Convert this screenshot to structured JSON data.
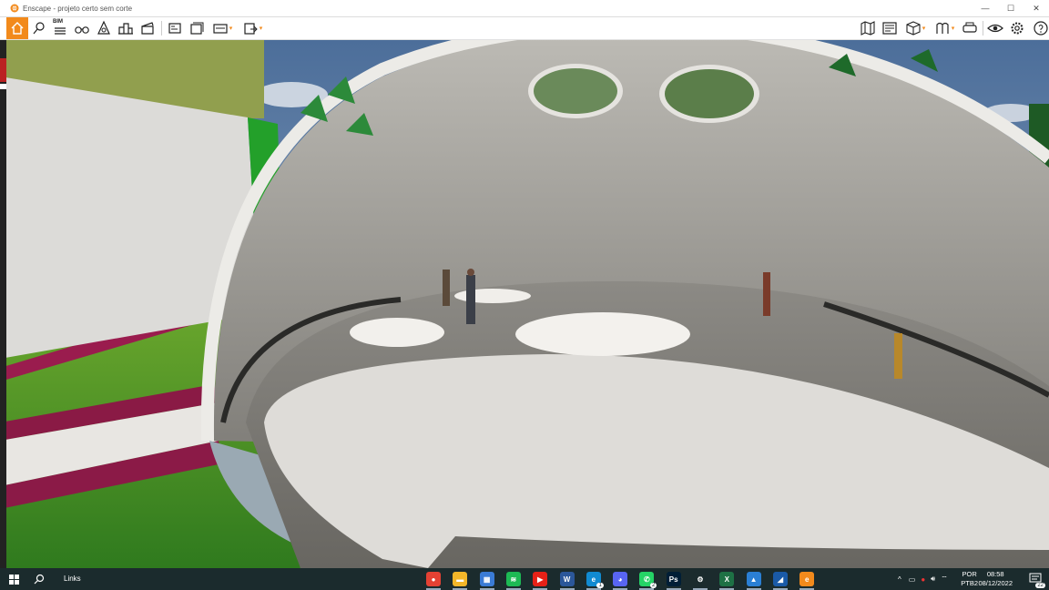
{
  "window": {
    "title": "Enscape - projeto certo sem corte",
    "minimize_label": "—",
    "maximize_label": "☐",
    "close_label": "✕"
  },
  "toolbar": {
    "left_icons": [
      "home-icon",
      "capture-pin-icon",
      "bim-icon",
      "binoculars-icon",
      "render-style-icon",
      "buildings-icon",
      "video-editor-icon",
      "screenshot-icon",
      "batch-render-icon",
      "panorama-icon",
      "export-icon"
    ],
    "bim_label": "BIM",
    "right_icons": [
      "map-icon",
      "asset-library-icon",
      "cube-icon",
      "materials-icon",
      "vr-headset-icon",
      "visual-settings-icon",
      "settings-icon",
      "help-icon"
    ],
    "collapse_glyph": "^"
  },
  "taskbar": {
    "start_icon": "windows-start-icon",
    "search_icon": "search-icon",
    "links_label": "Links",
    "apps": [
      {
        "name": "chrome-icon",
        "color": "#e44133",
        "glyph": "●"
      },
      {
        "name": "file-explorer-icon",
        "color": "#f3b629",
        "glyph": "▬"
      },
      {
        "name": "store-icon",
        "color": "#3a7bd5",
        "glyph": "▦"
      },
      {
        "name": "spotify-icon",
        "color": "#1db954",
        "glyph": "≋"
      },
      {
        "name": "youtube-icon",
        "color": "#e62117",
        "glyph": "▶"
      },
      {
        "name": "word-icon",
        "color": "#2b579a",
        "glyph": "W"
      },
      {
        "name": "edge-icon",
        "color": "#118ad1",
        "glyph": "e"
      },
      {
        "name": "discord-icon",
        "color": "#5865f2",
        "glyph": "◕"
      },
      {
        "name": "whatsapp-icon",
        "color": "#25d366",
        "glyph": "✆"
      },
      {
        "name": "photoshop-icon",
        "color": "#001e36",
        "glyph": "Ps"
      },
      {
        "name": "settings-app-icon",
        "color": "#1b2b2d",
        "glyph": "⚙"
      },
      {
        "name": "excel-icon",
        "color": "#1e7145",
        "glyph": "X"
      },
      {
        "name": "photos-icon",
        "color": "#2a7fd4",
        "glyph": "▲"
      },
      {
        "name": "sketchup-icon",
        "color": "#1a5aa7",
        "glyph": "◢"
      },
      {
        "name": "enscape-icon",
        "color": "#f28a1c",
        "glyph": "e"
      }
    ],
    "whatsapp_badge": "2",
    "edge_badge": "1",
    "tray_chevron": "^",
    "lang_top": "POR",
    "lang_bottom": "PTB2",
    "time": "08:58",
    "date": "08/12/2022",
    "notification_count": "22"
  },
  "colors": {
    "accent": "#f28a1c",
    "taskbar": "#1b2b2d"
  }
}
